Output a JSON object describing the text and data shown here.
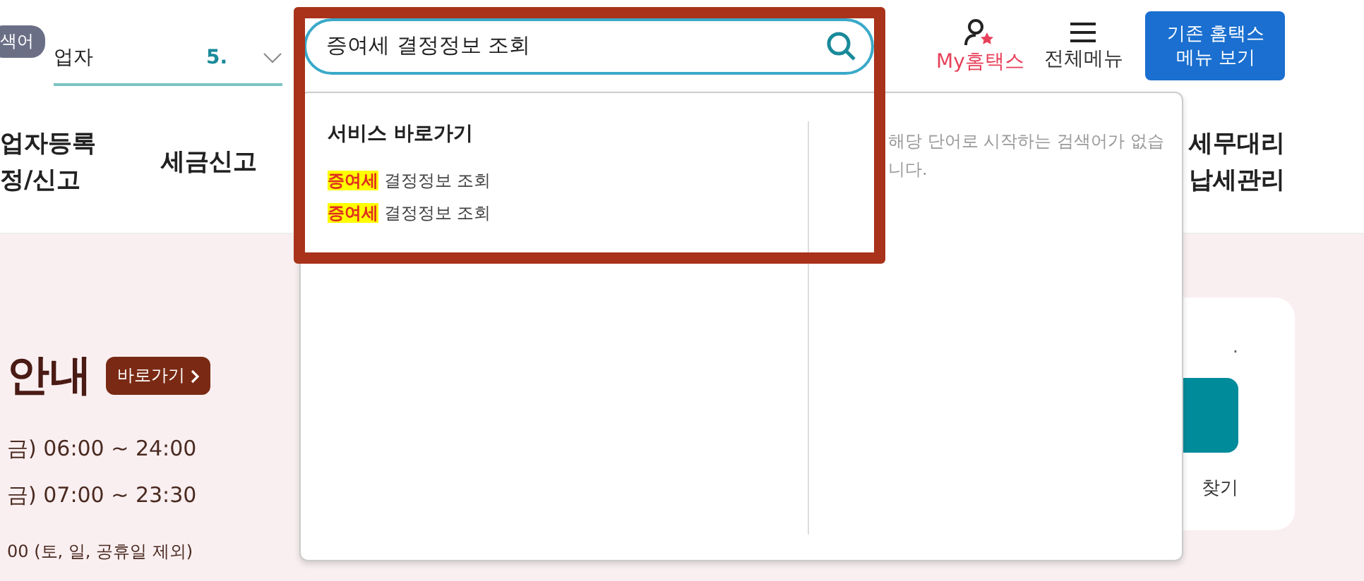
{
  "header": {
    "keyword_badge": "색어",
    "business_select": {
      "value": "업자"
    },
    "period_select": {
      "value": "5."
    },
    "search": {
      "value": "증여세 결정정보 조회"
    },
    "my_hometax": "My홈택스",
    "all_menu": "전체메뉴",
    "classic_button": [
      "기존 홈택스",
      "메뉴 보기"
    ]
  },
  "nav": [
    {
      "lines": [
        "업자등록",
        "정/신고"
      ]
    },
    {
      "lines": [
        "세금신고"
      ]
    },
    {
      "lines": [
        "세무대리",
        "납세관리"
      ]
    }
  ],
  "autocomplete": {
    "section_title": "서비스 바로가기",
    "items": [
      {
        "match": "증여세",
        "rest": "결정정보 조회"
      },
      {
        "match": "증여세",
        "rest": "결정정보 조회"
      }
    ],
    "no_result": "해당 단어로 시작하는 검색어가 없습니다."
  },
  "hero": {
    "title": "안내",
    "link": "바로가기",
    "hours": [
      "금) 06:00 ~ 24:00",
      "금) 07:00 ~ 23:30",
      "00 (토, 일, 공휴일 제외)"
    ]
  },
  "side_card": {
    "note": ".",
    "link": "찾기"
  }
}
